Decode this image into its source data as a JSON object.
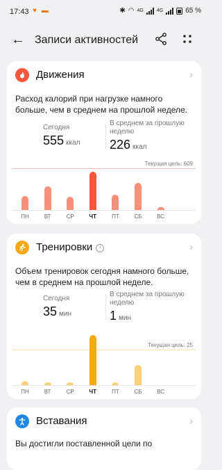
{
  "status": {
    "time": "17:43",
    "battery": "65 %",
    "net1": "4G",
    "net2": "4G"
  },
  "header": {
    "title": "Записи активностей"
  },
  "movement": {
    "title": "Движения",
    "description": "Расход калорий при нагрузке намного больше, чем в среднем на прошлой неделе.",
    "today_label": "Сегодня",
    "today_value": "555",
    "unit": "ккал",
    "avg_label": "В среднем за прошлую неделю",
    "avg_value": "226",
    "goal_label": "Текущая цель: 609",
    "color": "#f4573a",
    "days": [
      "ПН",
      "ВТ",
      "СР",
      "ЧТ",
      "ПТ",
      "СБ",
      "ВС"
    ],
    "values": [
      200,
      350,
      190,
      555,
      220,
      400,
      40
    ],
    "goal": 609
  },
  "workouts": {
    "title": "Тренировки",
    "description": "Объем тренировок сегодня намного больше, чем в среднем на прошлой неделе.",
    "today_label": "Сегодня",
    "today_value": "35",
    "unit": "мин",
    "avg_label": "В среднем за прошлую неделю",
    "avg_value": "1",
    "goal_label": "Текущая цель: 25",
    "color": "#f7a817",
    "days": [
      "ПН",
      "ВТ",
      "СР",
      "ЧТ",
      "ПТ",
      "СБ",
      "ВС"
    ],
    "values": [
      3,
      2,
      2,
      35,
      2,
      14,
      0
    ],
    "goal": 25
  },
  "standing": {
    "title": "Вставания",
    "description": "Вы достигли поставленной цели по",
    "color": "#1e88e5"
  }
}
